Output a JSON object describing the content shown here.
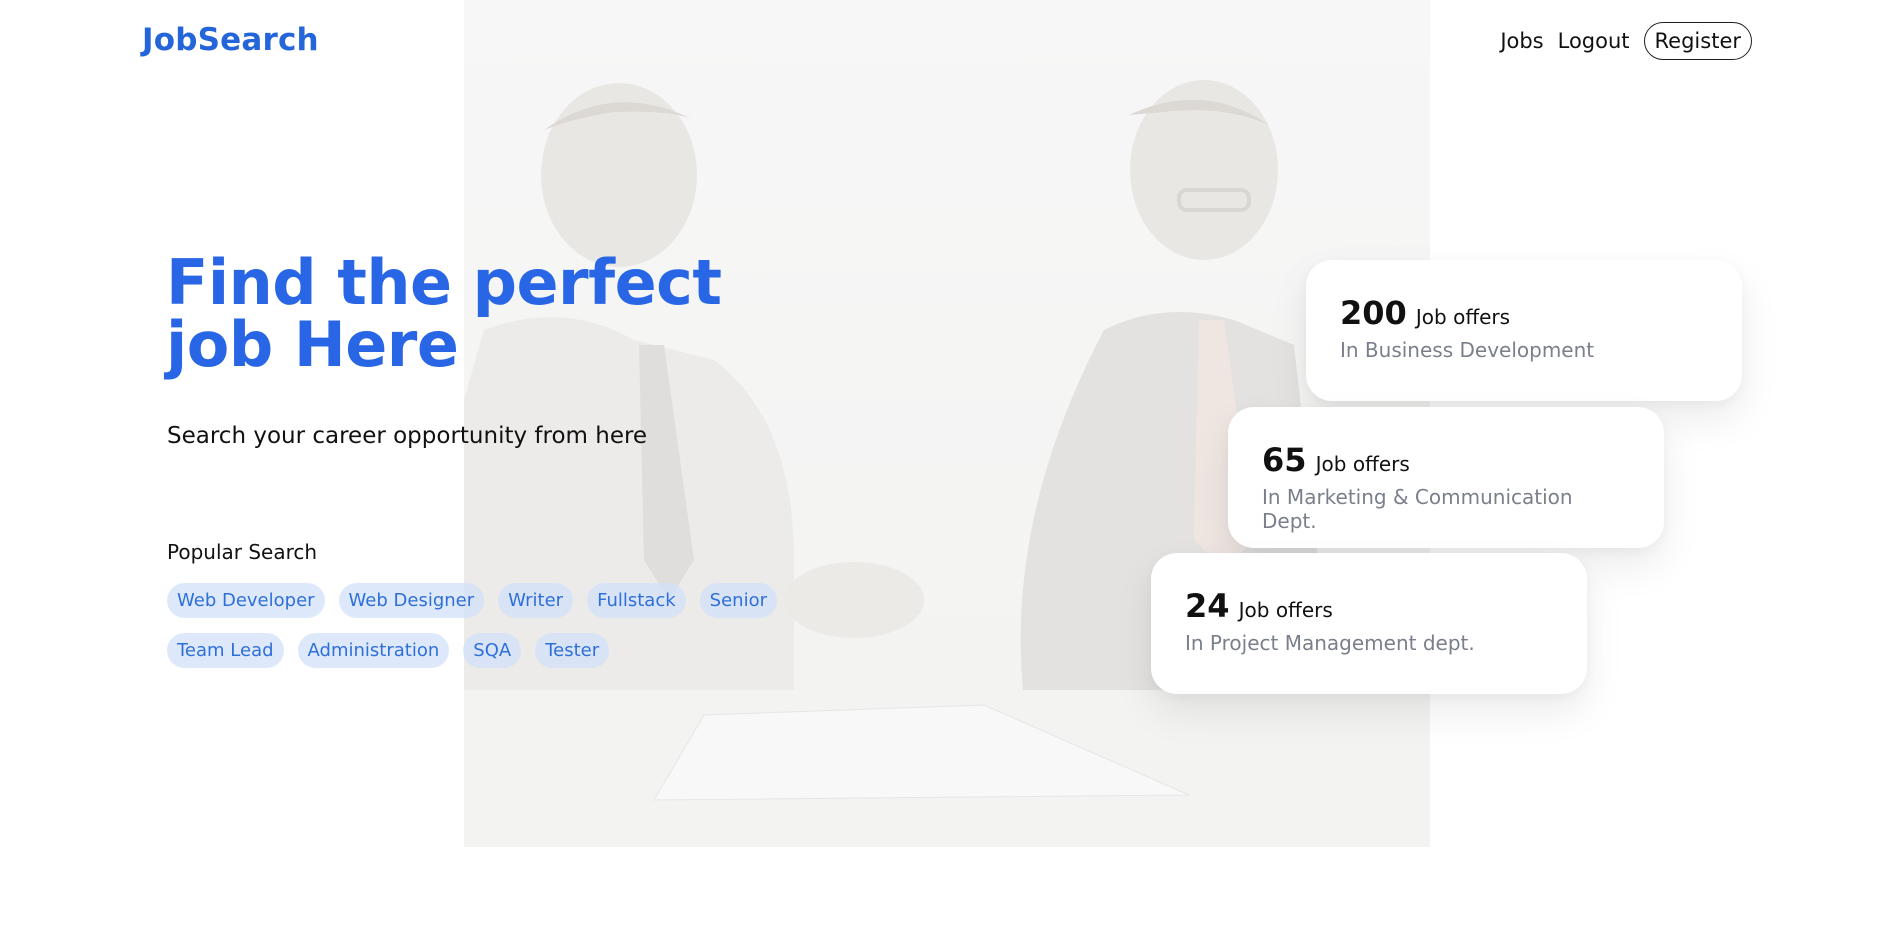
{
  "header": {
    "logo": "JobSearch",
    "nav": {
      "jobs": "Jobs",
      "logout": "Logout",
      "register": "Register"
    }
  },
  "hero": {
    "headline_line1": "Find the perfect",
    "headline_line2": "job Here",
    "subheadline": "Search your career opportunity from here",
    "popular_label": "Popular Search",
    "tags": [
      "Web Developer",
      "Web Designer",
      "Writer",
      "Fullstack",
      "Senior",
      "Team Lead",
      "Administration",
      "SQA",
      "Tester"
    ]
  },
  "stats": [
    {
      "count": "200",
      "label": "Job offers",
      "dept": "In Business Development"
    },
    {
      "count": "65",
      "label": "Job offers",
      "dept": "In Marketing & Communication Dept."
    },
    {
      "count": "24",
      "label": "Job offers",
      "dept": "In Project Management dept."
    }
  ],
  "colors": {
    "accent": "#2866e6",
    "logo": "#2466d9",
    "tag_bg": "#d2e1fa",
    "muted": "#7a7f8c"
  }
}
